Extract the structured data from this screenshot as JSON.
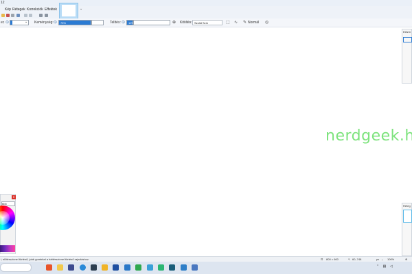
{
  "app": {
    "title_fragment": "12",
    "tab_arrow": "⌄"
  },
  "menu": {
    "items": [
      {
        "label": "Kép"
      },
      {
        "label": "Rétegek"
      },
      {
        "label": "Korrekciók"
      },
      {
        "label": "Effektek"
      }
    ]
  },
  "options": {
    "brush_label": "ec",
    "hardness_label": "Keménység:",
    "hardness_value": "75%",
    "fill_label": "Telítés:",
    "fill_value": "10%",
    "fill_mode_label": "Kitöltés:",
    "fill_mode_value": "Szolid Szín",
    "blend_value": "Normál"
  },
  "colors_panel": {
    "dropdown_value": "bbb"
  },
  "right_panels": {
    "history_title": "Előzm",
    "layers_title": "Réteg"
  },
  "status": {
    "hint": "i, előtérszínnel történő, jobb gombbal a háttérszínnel történő rajzoláshoz.",
    "canvas_size": "800 × 600",
    "cursor_pos": "60, 748",
    "unit": "px",
    "zoom": "100%"
  },
  "colors": {
    "accent": "#2b7bd3",
    "watermark": "#7de37d"
  },
  "watermark": "nerdgeek.hu",
  "taskbar": {
    "icons": [
      "brave-icon",
      "file-explorer-icon",
      "vpn-icon",
      "edge-icon",
      "store-icon",
      "files-icon",
      "mail-icon",
      "calendar-icon",
      "xbox-icon",
      "photos-icon",
      "paint-icon",
      "notes-icon",
      "paintdotnet-icon"
    ]
  }
}
